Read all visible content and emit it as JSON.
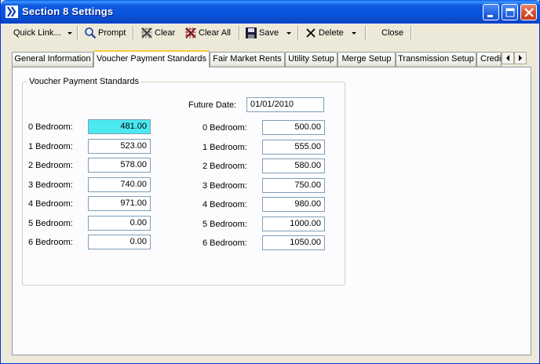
{
  "window": {
    "title": "Section 8 Settings"
  },
  "toolbar": {
    "quick_link": "Quick Link...",
    "prompt": "Prompt",
    "clear": "Clear",
    "clear_all": "Clear All",
    "save": "Save",
    "delete": "Delete",
    "close": "Close"
  },
  "tabs": [
    {
      "label": "General Information"
    },
    {
      "label": "Voucher Payment Standards"
    },
    {
      "label": "Fair Market Rents"
    },
    {
      "label": "Utility Setup"
    },
    {
      "label": "Merge Setup"
    },
    {
      "label": "Transmission Setup"
    },
    {
      "label": "Credit"
    }
  ],
  "active_tab": "Voucher Payment Standards",
  "group": {
    "title": "Voucher Payment Standards",
    "future_date_label": "Future Date:",
    "future_date_value": "01/01/2010",
    "current": [
      {
        "label": "0 Bedroom:",
        "value": "481.00"
      },
      {
        "label": "1 Bedroom:",
        "value": "523.00"
      },
      {
        "label": "2 Bedroom:",
        "value": "578.00"
      },
      {
        "label": "3 Bedroom:",
        "value": "740.00"
      },
      {
        "label": "4 Bedroom:",
        "value": "971.00"
      },
      {
        "label": "5 Bedroom:",
        "value": "0.00"
      },
      {
        "label": "6 Bedroom:",
        "value": "0.00"
      }
    ],
    "future": [
      {
        "label": "0 Bedroom:",
        "value": "500.00"
      },
      {
        "label": "1 Bedroom:",
        "value": "555.00"
      },
      {
        "label": "2 Bedroom:",
        "value": "580.00"
      },
      {
        "label": "3 Bedroom:",
        "value": "750.00"
      },
      {
        "label": "4 Bedroom:",
        "value": "980.00"
      },
      {
        "label": "5 Bedroom:",
        "value": "1000.00"
      },
      {
        "label": "6 Bedroom:",
        "value": "1050.00"
      }
    ]
  },
  "colors": {
    "titlebar": "#0a5fe8",
    "selected_field": "#4ceaf0",
    "active_tab_accent": "#ffc83c"
  }
}
